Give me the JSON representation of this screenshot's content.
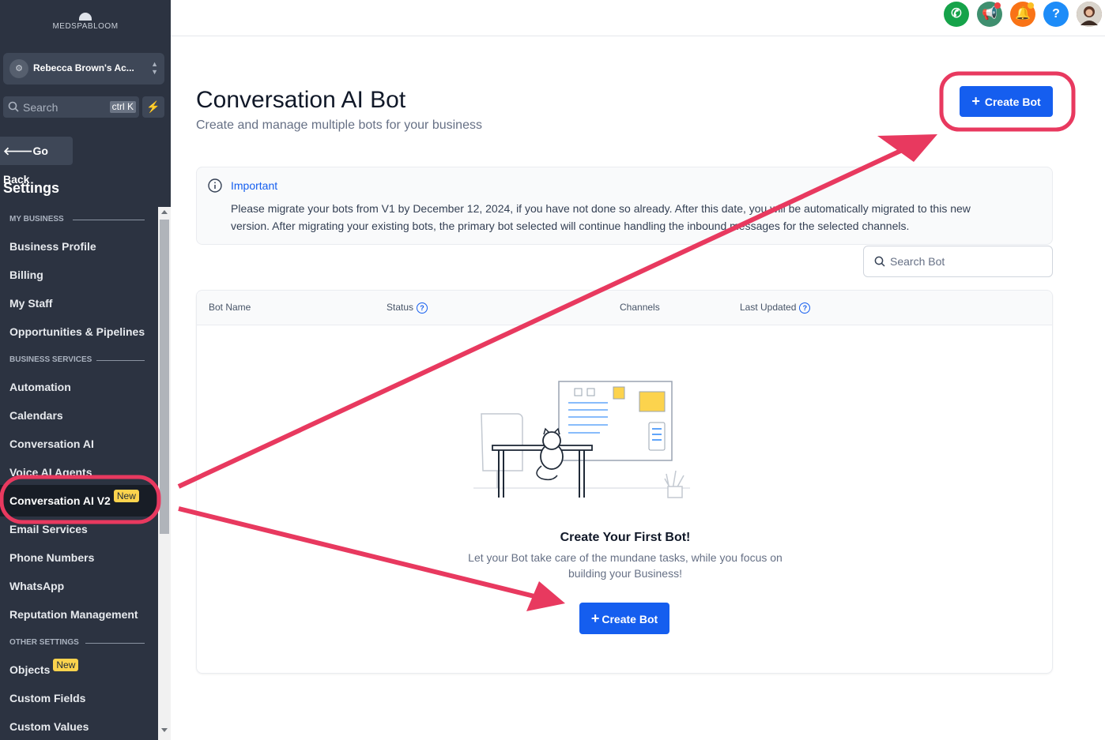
{
  "brand": "MEDSPABLOOM",
  "account": {
    "name": "Rebecca Brown's Ac..."
  },
  "search": {
    "placeholder": "Search",
    "shortcut": "ctrl K"
  },
  "go_back": "Go Back",
  "settings_title": "Settings",
  "sidebar": {
    "sections": [
      {
        "label": "MY BUSINESS"
      },
      {
        "label": "BUSINESS SERVICES"
      },
      {
        "label": "OTHER SETTINGS"
      }
    ],
    "items": [
      {
        "label": "Business Profile"
      },
      {
        "label": "Billing"
      },
      {
        "label": "My Staff"
      },
      {
        "label": "Opportunities & Pipelines"
      },
      {
        "label": "Automation"
      },
      {
        "label": "Calendars"
      },
      {
        "label": "Conversation AI"
      },
      {
        "label": "Voice AI Agents"
      },
      {
        "label": "Conversation AI V2",
        "badge": "New",
        "active": true
      },
      {
        "label": "Email Services"
      },
      {
        "label": "Phone Numbers"
      },
      {
        "label": "WhatsApp"
      },
      {
        "label": "Reputation Management"
      },
      {
        "label": "Objects",
        "badge": "New"
      },
      {
        "label": "Custom Fields"
      },
      {
        "label": "Custom Values"
      }
    ]
  },
  "topbar": {
    "icons": [
      "phone-icon",
      "megaphone-icon",
      "bell-icon",
      "help-icon",
      "user-avatar"
    ],
    "help_glyph": "?",
    "colors": {
      "phone": "#16a34a",
      "megaphone": "#3f8f6f",
      "bell": "#f97316",
      "help": "#1d8cf8"
    }
  },
  "page": {
    "title": "Conversation AI Bot",
    "subtitle": "Create and manage multiple bots for your business",
    "create_button": "Create Bot"
  },
  "notice": {
    "heading": "Important",
    "body": "Please migrate your bots from V1 by December 12, 2024, if you have not done so already. After this date, you will be automatically migrated to this new version. After migrating your existing bots, the primary bot selected will continue handling the inbound messages for the selected channels."
  },
  "bot_search": {
    "placeholder": "Search Bot"
  },
  "table": {
    "columns": [
      "Bot Name",
      "Status",
      "Channels",
      "Last Updated"
    ]
  },
  "empty_state": {
    "heading": "Create Your First Bot!",
    "body": "Let your Bot take care of the mundane tasks, while you focus on building your Business!",
    "button": "Create Bot"
  },
  "colors": {
    "primary": "#155eef",
    "sidebar": "#2c3341",
    "annotation": "#e8395f",
    "badge": "#fcd34d"
  }
}
